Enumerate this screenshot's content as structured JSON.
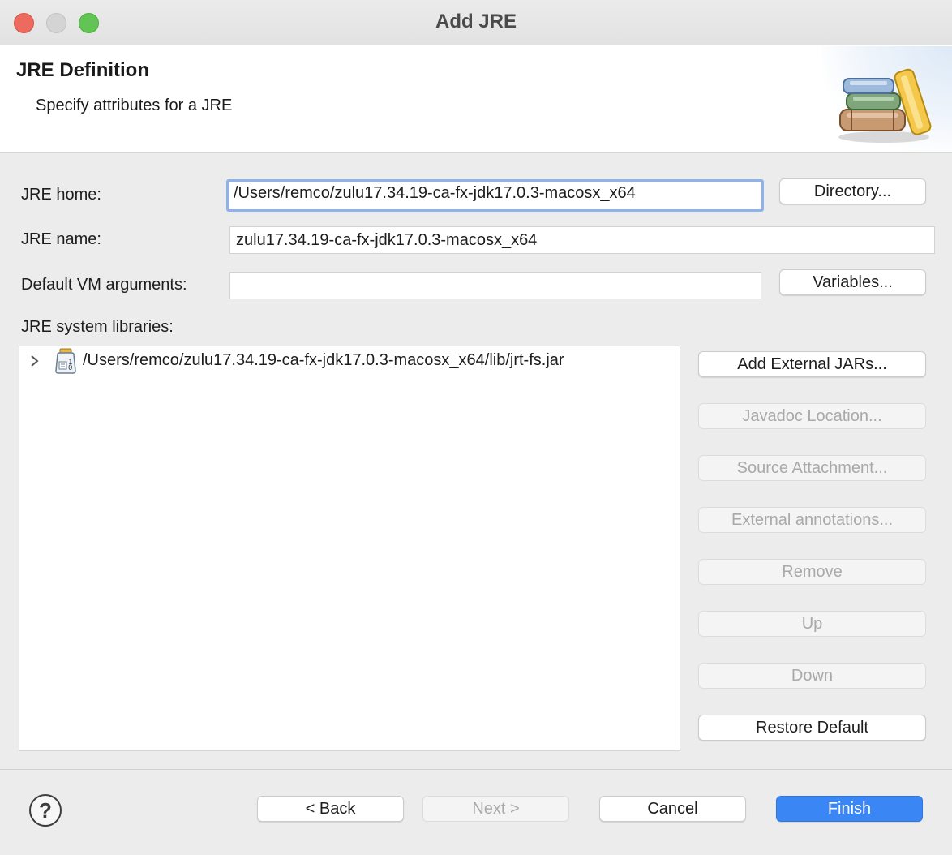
{
  "window": {
    "title": "Add JRE"
  },
  "banner": {
    "title": "JRE Definition",
    "subtitle": "Specify attributes for a JRE",
    "icon": "library-books-icon"
  },
  "form": {
    "jre_home": {
      "label": "JRE home:",
      "value": "/Users/remco/zulu17.34.19-ca-fx-jdk17.0.3-macosx_x64",
      "button": "Directory..."
    },
    "jre_name": {
      "label": "JRE name:",
      "value": "zulu17.34.19-ca-fx-jdk17.0.3-macosx_x64"
    },
    "vm_args": {
      "label": "Default VM arguments:",
      "value": "",
      "button": "Variables..."
    },
    "libraries": {
      "label": "JRE system libraries:",
      "items": [
        {
          "label": "/Users/remco/zulu17.34.19-ca-fx-jdk17.0.3-macosx_x64/lib/jrt-fs.jar",
          "expanded": false,
          "icon": "jar-icon"
        }
      ]
    }
  },
  "library_buttons": {
    "add_external_jars": {
      "label": "Add External JARs...",
      "enabled": true
    },
    "javadoc_location": {
      "label": "Javadoc Location...",
      "enabled": false
    },
    "source_attachment": {
      "label": "Source Attachment...",
      "enabled": false
    },
    "external_annotations": {
      "label": "External annotations...",
      "enabled": false
    },
    "remove": {
      "label": "Remove",
      "enabled": false
    },
    "up": {
      "label": "Up",
      "enabled": false
    },
    "down": {
      "label": "Down",
      "enabled": false
    },
    "restore_default": {
      "label": "Restore Default",
      "enabled": true
    }
  },
  "footer": {
    "help": "?",
    "back": {
      "label": "< Back",
      "enabled": true
    },
    "next": {
      "label": "Next >",
      "enabled": false
    },
    "cancel": {
      "label": "Cancel",
      "enabled": true
    },
    "finish": {
      "label": "Finish",
      "enabled": true
    }
  },
  "colors": {
    "accent": "#3b86f5",
    "focus_ring": "#8fb2ea",
    "close": "#ed6a5e",
    "maximize": "#61c454",
    "minimize_inactive": "#d4d4d4",
    "disabled_text": "#a9a9a9"
  }
}
